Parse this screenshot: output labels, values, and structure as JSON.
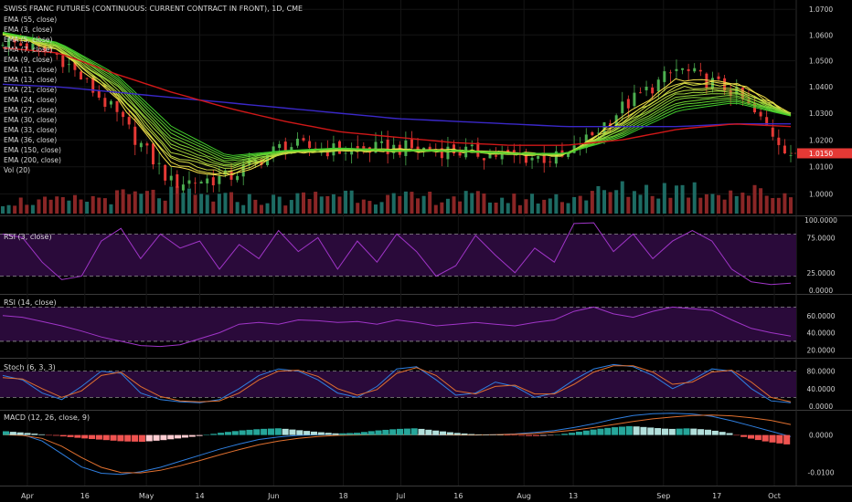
{
  "header": {
    "title": "SWISS FRANC FUTURES (CONTINUOUS: CURRENT CONTRACT IN FRONT), 1D, CME"
  },
  "colors": {
    "background": "#000000",
    "up_candle": "#4caf50",
    "down_candle": "#e53935",
    "ema_fast": "#f5e04a",
    "ema_mid": "#3fd33f",
    "ema150": "#d01818",
    "ema200": "#3a28c8",
    "rsi_line": "#a035c8",
    "band_fill": "#2a0a3a",
    "stoch_k": "#2f7fe0",
    "stoch_d": "#e0702f",
    "macd_pos": "#26a69a",
    "macd_pos_light": "#b2dfdb",
    "macd_neg": "#ef5350",
    "macd_neg_light": "#ffcdd2",
    "last_price_bg": "#e53935"
  },
  "last_price": {
    "label": "1.0150",
    "value": 1.015
  },
  "chart_data": [
    {
      "type": "line",
      "panel": "price",
      "y_scale": "log",
      "ylim": [
        0.9935,
        1.0715
      ],
      "y_ticks": [
        1.0,
        1.01,
        1.02,
        1.03,
        1.04,
        1.05,
        1.06,
        1.07
      ],
      "y_tick_labels": [
        "1.0000",
        "1.0100",
        "1.0200",
        "1.0300",
        "1.0400",
        "1.0500",
        "1.0600",
        "1.0700"
      ],
      "x_ticks": [
        {
          "label": "Apr",
          "date": "2018-04-02"
        },
        {
          "label": "16",
          "date": "2018-04-16"
        },
        {
          "label": "May",
          "date": "2018-05-01"
        },
        {
          "label": "14",
          "date": "2018-05-14"
        },
        {
          "label": "Jun",
          "date": "2018-06-01"
        },
        {
          "label": "18",
          "date": "2018-06-18"
        },
        {
          "label": "Jul",
          "date": "2018-07-02"
        },
        {
          "label": "16",
          "date": "2018-07-16"
        },
        {
          "label": "Aug",
          "date": "2018-08-01"
        },
        {
          "label": "13",
          "date": "2018-08-13"
        },
        {
          "label": "Sep",
          "date": "2018-09-04"
        },
        {
          "label": "17",
          "date": "2018-09-17"
        },
        {
          "label": "Oct",
          "date": "2018-10-01"
        }
      ],
      "legend": [
        "EMA (55, close)",
        "EMA (3, close)",
        "EMA (5, close)",
        "EMA (7, close)",
        "EMA (9, close)",
        "EMA (11, close)",
        "EMA (13, close)",
        "EMA (21, close)",
        "EMA (24, close)",
        "EMA (27, close)",
        "EMA (30, close)",
        "EMA (33, close)",
        "EMA (36, close)",
        "EMA (150, close)",
        "EMA (200, close)",
        "Vol (20)"
      ],
      "legend_placement": "top-left",
      "candles": {
        "dates": [
          "2018-03-27",
          "2018-04-10",
          "2018-04-24",
          "2018-05-08",
          "2018-05-22",
          "2018-06-05",
          "2018-06-19",
          "2018-07-03",
          "2018-07-17",
          "2018-07-31",
          "2018-08-14",
          "2018-08-28",
          "2018-09-11",
          "2018-09-25",
          "2018-10-05"
        ],
        "close": [
          1.058,
          1.052,
          1.03,
          1.004,
          1.006,
          1.018,
          1.016,
          1.017,
          1.016,
          1.014,
          1.013,
          1.032,
          1.047,
          1.038,
          1.015
        ]
      },
      "ema_fast_series": [
        1.06,
        1.054,
        1.036,
        1.01,
        1.006,
        1.015,
        1.016,
        1.016,
        1.016,
        1.015,
        1.014,
        1.028,
        1.043,
        1.042,
        1.03
      ],
      "ema_mid_series": [
        1.061,
        1.057,
        1.045,
        1.025,
        1.014,
        1.016,
        1.017,
        1.016,
        1.016,
        1.015,
        1.015,
        1.021,
        1.031,
        1.034,
        1.029
      ],
      "ema150_series": [
        1.055,
        1.053,
        1.045,
        1.038,
        1.032,
        1.027,
        1.023,
        1.021,
        1.019,
        1.018,
        1.018,
        1.02,
        1.024,
        1.026,
        1.025
      ],
      "ema200_series": [
        1.041,
        1.04,
        1.038,
        1.036,
        1.034,
        1.032,
        1.03,
        1.028,
        1.027,
        1.026,
        1.025,
        1.025,
        1.025,
        1.026,
        1.026
      ],
      "volume": [
        30,
        28,
        40,
        45,
        36,
        32,
        50,
        35,
        40,
        33,
        38,
        55,
        60,
        52,
        45
      ]
    },
    {
      "type": "line",
      "panel": "rsi3",
      "title": "RSI (3, close)",
      "ylim": [
        0,
        100
      ],
      "y_tick_labels": [
        "100.0000",
        "75.0000",
        "25.0000",
        "0.0000"
      ],
      "y_ticks": [
        100,
        75,
        25,
        0
      ],
      "band": [
        20,
        80
      ],
      "values": [
        80,
        75,
        40,
        15,
        20,
        70,
        88,
        45,
        80,
        60,
        70,
        30,
        65,
        45,
        85,
        55,
        75,
        30,
        70,
        40,
        80,
        55,
        20,
        35,
        78,
        50,
        25,
        60,
        40,
        95,
        96,
        55,
        80,
        45,
        70,
        85,
        70,
        30,
        12,
        8,
        10
      ]
    },
    {
      "type": "line",
      "panel": "rsi14",
      "title": "RSI (14, close)",
      "ylim": [
        15,
        80
      ],
      "y_ticks": [
        60,
        40,
        20
      ],
      "y_tick_labels": [
        "60.0000",
        "40.0000",
        "20.0000"
      ],
      "band": [
        30,
        70
      ],
      "values": [
        60,
        58,
        53,
        48,
        42,
        35,
        30,
        25,
        24,
        26,
        33,
        40,
        50,
        52,
        50,
        55,
        54,
        52,
        53,
        50,
        55,
        52,
        48,
        50,
        52,
        50,
        48,
        52,
        55,
        65,
        70,
        62,
        58,
        65,
        70,
        68,
        66,
        55,
        45,
        40,
        36
      ]
    },
    {
      "type": "line",
      "panel": "stoch",
      "title": "Stoch (6, 3, 3)",
      "ylim": [
        0,
        100
      ],
      "y_ticks": [
        80,
        40,
        0
      ],
      "y_tick_labels": [
        "80.0000",
        "40.0000",
        "0.0000"
      ],
      "band": [
        20,
        80
      ],
      "series": [
        {
          "values": [
            70,
            60,
            30,
            15,
            45,
            80,
            75,
            30,
            15,
            10,
            8,
            15,
            40,
            70,
            85,
            80,
            60,
            30,
            20,
            45,
            85,
            90,
            60,
            25,
            30,
            55,
            45,
            20,
            30,
            60,
            85,
            95,
            90,
            70,
            40,
            60,
            85,
            80,
            40,
            12,
            8
          ]
        },
        {
          "values": [
            65,
            62,
            40,
            20,
            35,
            70,
            78,
            45,
            22,
            12,
            10,
            12,
            30,
            60,
            80,
            82,
            68,
            40,
            25,
            38,
            75,
            88,
            70,
            35,
            28,
            45,
            48,
            28,
            28,
            50,
            78,
            92,
            92,
            78,
            50,
            55,
            78,
            82,
            55,
            20,
            10
          ]
        }
      ]
    },
    {
      "type": "bar",
      "panel": "macd",
      "title": "MACD (12, 26, close, 9)",
      "ylim": [
        -0.0125,
        0.0055
      ],
      "y_ticks": [
        0.0,
        -0.01
      ],
      "y_tick_labels": [
        "0.0000",
        "-0.0100"
      ],
      "histogram": [
        0.001,
        0.0006,
        0.0001,
        -0.0004,
        -0.0009,
        -0.0013,
        -0.0017,
        -0.0018,
        -0.0014,
        -0.0008,
        -0.0002,
        0.0006,
        0.0012,
        0.0016,
        0.0018,
        0.0013,
        0.0008,
        0.0004,
        0.0006,
        0.0012,
        0.0016,
        0.0018,
        0.0012,
        0.0006,
        0.0002,
        0.0001,
        -0.0001,
        -0.0003,
        -0.0001,
        0.0006,
        0.0014,
        0.002,
        0.0024,
        0.002,
        0.0016,
        0.0018,
        0.0014,
        0.0006,
        -0.0008,
        -0.0018,
        -0.0025
      ],
      "series": [
        {
          "values": [
            0.0005,
            0.0001,
            -0.0016,
            -0.005,
            -0.0085,
            -0.0102,
            -0.0105,
            -0.0098,
            -0.0086,
            -0.007,
            -0.0054,
            -0.0038,
            -0.0024,
            -0.0012,
            -0.0005,
            -0.0001,
            0.0001,
            0.0002,
            0.0002,
            0.0002,
            0.0001,
            0.0001,
            0.0,
            0.0,
            0.0,
            0.0001,
            0.0003,
            0.0007,
            0.0012,
            0.002,
            0.003,
            0.0042,
            0.0052,
            0.0057,
            0.0058,
            0.0056,
            0.005,
            0.0038,
            0.0024,
            0.001,
            -0.0004
          ]
        },
        {
          "values": [
            0.0001,
            -0.0001,
            -0.0009,
            -0.003,
            -0.006,
            -0.0086,
            -0.01,
            -0.0101,
            -0.0094,
            -0.0082,
            -0.0068,
            -0.0053,
            -0.0039,
            -0.0026,
            -0.0016,
            -0.0009,
            -0.0004,
            -0.0001,
            0.0,
            0.0001,
            0.0001,
            0.0001,
            0.0001,
            0.0,
            0.0,
            0.0001,
            0.0002,
            0.0004,
            0.0008,
            0.0013,
            0.002,
            0.0028,
            0.0036,
            0.0043,
            0.0048,
            0.0052,
            0.0053,
            0.0051,
            0.0046,
            0.0039,
            0.0028
          ]
        }
      ]
    }
  ]
}
